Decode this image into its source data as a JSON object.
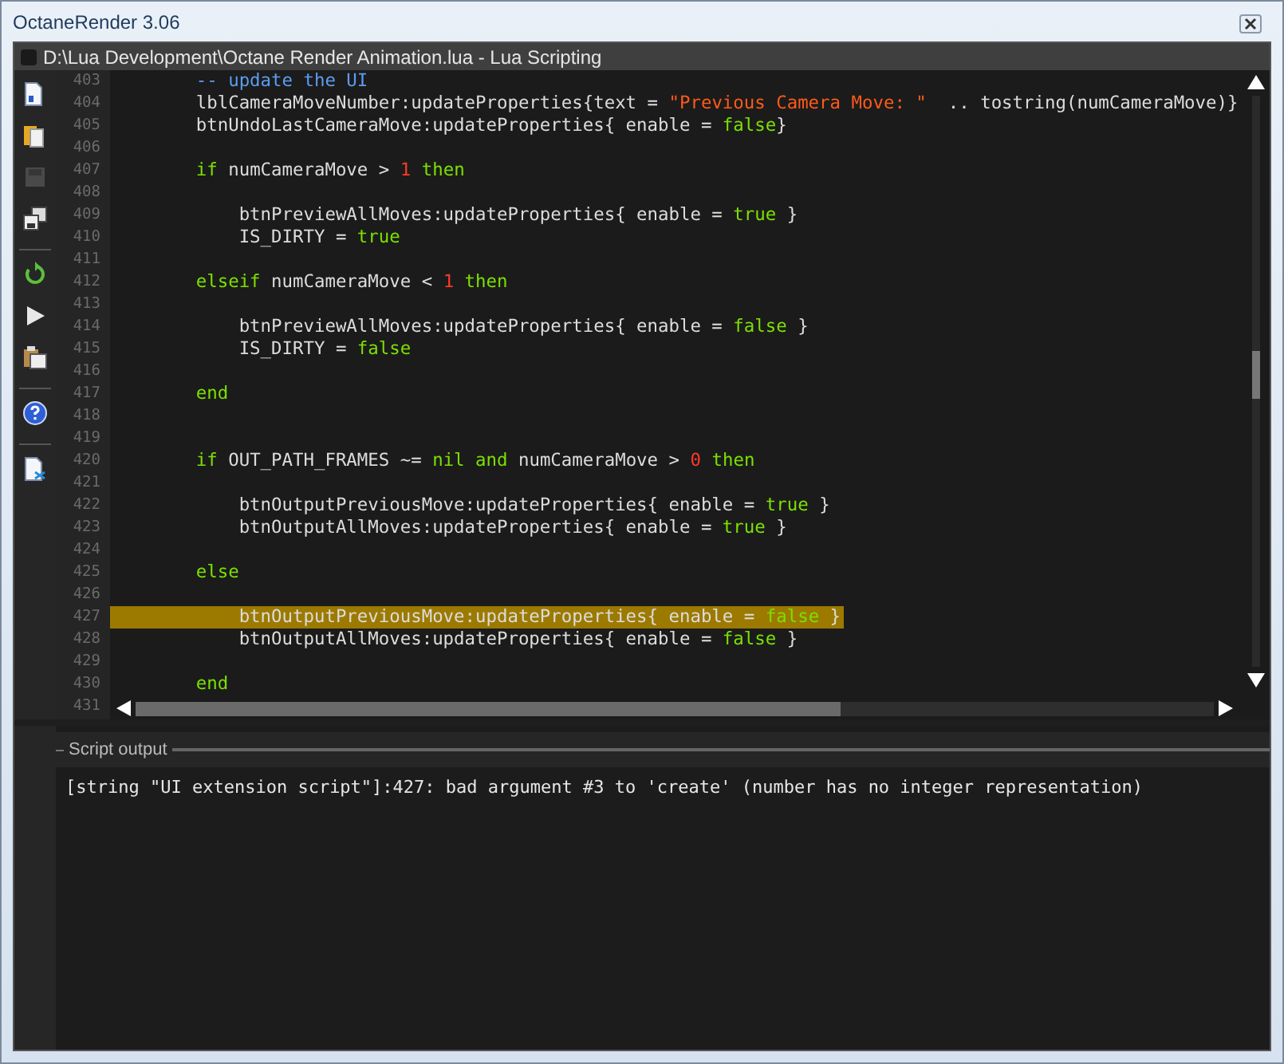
{
  "window": {
    "title": "OctaneRender 3.06"
  },
  "editor_window": {
    "title": "D:\\Lua Development\\Octane Render Animation.lua - Lua Scripting"
  },
  "toolbar": [
    {
      "kind": "new",
      "disabled": false
    },
    {
      "kind": "open",
      "disabled": false
    },
    {
      "kind": "save",
      "disabled": true
    },
    {
      "kind": "save-as",
      "disabled": false
    },
    {
      "kind": "separator"
    },
    {
      "kind": "reload",
      "disabled": false
    },
    {
      "kind": "run",
      "disabled": false
    },
    {
      "kind": "paste",
      "disabled": false
    },
    {
      "kind": "separator"
    },
    {
      "kind": "help",
      "disabled": false
    },
    {
      "kind": "separator"
    },
    {
      "kind": "script",
      "disabled": false
    }
  ],
  "code_lines": [
    {
      "number": "403",
      "highlighted": false,
      "tokens": [
        {
          "kind": "comment",
          "text": "        -- update the UI"
        }
      ]
    },
    {
      "number": "404",
      "highlighted": false,
      "tokens": [
        {
          "kind": "plain",
          "text": "        lblCameraMoveNumber:updateProperties{text = "
        },
        {
          "kind": "string",
          "text": "\"Previous Camera Move: \""
        },
        {
          "kind": "plain",
          "text": "  .. tostring(numCameraMove)}"
        }
      ]
    },
    {
      "number": "405",
      "highlighted": false,
      "tokens": [
        {
          "kind": "plain",
          "text": "        btnUndoLastCameraMove:updateProperties{ enable = "
        },
        {
          "kind": "keyword",
          "text": "false"
        },
        {
          "kind": "plain",
          "text": "}"
        }
      ]
    },
    {
      "number": "406"
    },
    {
      "number": "407",
      "highlighted": false,
      "tokens": [
        {
          "kind": "keyword",
          "text": "        if"
        },
        {
          "kind": "plain",
          "text": " numCameraMove > "
        },
        {
          "kind": "number",
          "text": "1"
        },
        {
          "kind": "keyword",
          "text": " then"
        }
      ]
    },
    {
      "number": "408"
    },
    {
      "number": "409",
      "highlighted": false,
      "tokens": [
        {
          "kind": "plain",
          "text": "            btnPreviewAllMoves:updateProperties{ enable = "
        },
        {
          "kind": "keyword",
          "text": "true"
        },
        {
          "kind": "plain",
          "text": " }"
        }
      ]
    },
    {
      "number": "410",
      "highlighted": false,
      "tokens": [
        {
          "kind": "plain",
          "text": "            IS_DIRTY = "
        },
        {
          "kind": "keyword",
          "text": "true"
        }
      ]
    },
    {
      "number": "411"
    },
    {
      "number": "412",
      "highlighted": false,
      "tokens": [
        {
          "kind": "keyword",
          "text": "        elseif"
        },
        {
          "kind": "plain",
          "text": " numCameraMove < "
        },
        {
          "kind": "number",
          "text": "1"
        },
        {
          "kind": "keyword",
          "text": " then"
        }
      ]
    },
    {
      "number": "413"
    },
    {
      "number": "414",
      "highlighted": false,
      "tokens": [
        {
          "kind": "plain",
          "text": "            btnPreviewAllMoves:updateProperties{ enable = "
        },
        {
          "kind": "keyword",
          "text": "false"
        },
        {
          "kind": "plain",
          "text": " }"
        }
      ]
    },
    {
      "number": "415",
      "highlighted": false,
      "tokens": [
        {
          "kind": "plain",
          "text": "            IS_DIRTY = "
        },
        {
          "kind": "keyword",
          "text": "false"
        }
      ]
    },
    {
      "number": "416"
    },
    {
      "number": "417",
      "highlighted": false,
      "tokens": [
        {
          "kind": "keyword",
          "text": "        end"
        }
      ]
    },
    {
      "number": "418"
    },
    {
      "number": "419"
    },
    {
      "number": "420",
      "highlighted": false,
      "tokens": [
        {
          "kind": "keyword",
          "text": "        if"
        },
        {
          "kind": "plain",
          "text": " OUT_PATH_FRAMES ~= "
        },
        {
          "kind": "keyword",
          "text": "nil and"
        },
        {
          "kind": "plain",
          "text": " numCameraMove > "
        },
        {
          "kind": "number",
          "text": "0"
        },
        {
          "kind": "keyword",
          "text": " then"
        }
      ]
    },
    {
      "number": "421"
    },
    {
      "number": "422",
      "highlighted": false,
      "tokens": [
        {
          "kind": "plain",
          "text": "            btnOutputPreviousMove:updateProperties{ enable = "
        },
        {
          "kind": "keyword",
          "text": "true"
        },
        {
          "kind": "plain",
          "text": " }"
        }
      ]
    },
    {
      "number": "423",
      "highlighted": false,
      "tokens": [
        {
          "kind": "plain",
          "text": "            btnOutputAllMoves:updateProperties{ enable = "
        },
        {
          "kind": "keyword",
          "text": "true"
        },
        {
          "kind": "plain",
          "text": " }"
        }
      ]
    },
    {
      "number": "424"
    },
    {
      "number": "425",
      "highlighted": false,
      "tokens": [
        {
          "kind": "keyword",
          "text": "        else"
        }
      ]
    },
    {
      "number": "426"
    },
    {
      "number": "427",
      "highlighted": true,
      "tokens": [
        {
          "kind": "plain",
          "text": "            btnOutputPreviousMove:updateProperties{ enable = "
        },
        {
          "kind": "keyword",
          "text": "false"
        },
        {
          "kind": "plain",
          "text": " }"
        }
      ]
    },
    {
      "number": "428",
      "highlighted": false,
      "tokens": [
        {
          "kind": "plain",
          "text": "            btnOutputAllMoves:updateProperties{ enable = "
        },
        {
          "kind": "keyword",
          "text": "false"
        },
        {
          "kind": "plain",
          "text": " }"
        }
      ]
    },
    {
      "number": "429"
    },
    {
      "number": "430",
      "highlighted": false,
      "tokens": [
        {
          "kind": "keyword",
          "text": "        end"
        }
      ]
    },
    {
      "number": "431"
    }
  ],
  "script_output": {
    "title": "Script output",
    "lines": [
      "[string \"UI extension script\"]:427: bad argument #3 to 'create' (number has no integer representation)"
    ]
  }
}
